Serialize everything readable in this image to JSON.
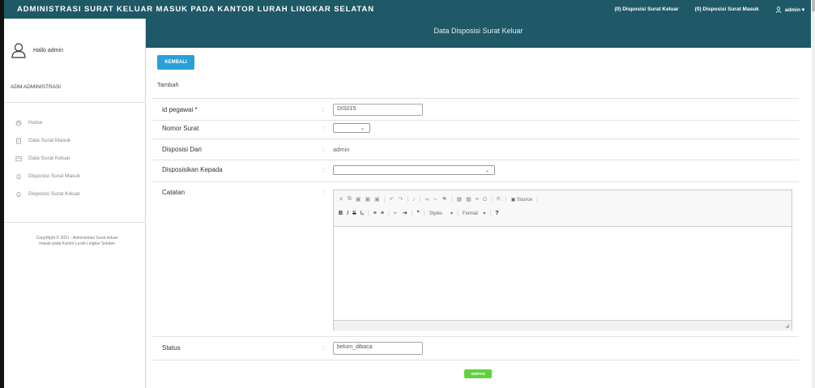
{
  "app": {
    "title": "ADMINISTRASI SURAT KELUAR MASUK PADA KANTOR LURAH LINGKAR SELATAN",
    "nav": {
      "disposisi_keluar": "(0) Disposisi Surat Keluar",
      "disposisi_masuk": "(0) Disposisi Surat Masuk",
      "user": "admin ▾"
    },
    "page_subtitle": "Data Disposisi Surat Keluar"
  },
  "sidebar": {
    "hello": "Hallo admin",
    "role": "ADM ADMINISTRASI",
    "items": [
      {
        "label": "Home",
        "icon": "home-icon"
      },
      {
        "label": "Data Surat Masuk",
        "icon": "document-icon"
      },
      {
        "label": "Data Surat Keluar",
        "icon": "folder-icon"
      },
      {
        "label": "Disposisi Surat Masuk",
        "icon": "bell-icon"
      },
      {
        "label": "Disposisi Surat Keluar",
        "icon": "bell-icon"
      }
    ],
    "copyright_line1": "CopyRight © 2021 - Administrasi Surat keluar",
    "copyright_line2": "masuk pada Kantor Lurah Lingkar Selatan"
  },
  "form": {
    "back_label": "KEMBALI",
    "tambah": "Tambah",
    "fields": {
      "id_pegawai": {
        "label": "id pegawai *",
        "value": "DIS015"
      },
      "nomor_surat": {
        "label": "Nomor Surat",
        "value": ""
      },
      "disposisi_dari": {
        "label": "Disposisi Dari",
        "value": "admin"
      },
      "disposisikan_kepada": {
        "label": "Disposisikan Kepada",
        "value": ""
      },
      "catatan": {
        "label": "Catatan"
      },
      "status": {
        "label": "Status",
        "value": "belum_dibaca"
      }
    },
    "colon": ":",
    "editor": {
      "source_label": "Source",
      "styles_label": "Styles",
      "format_label": "Format"
    },
    "save_label": "SIMPAN"
  }
}
